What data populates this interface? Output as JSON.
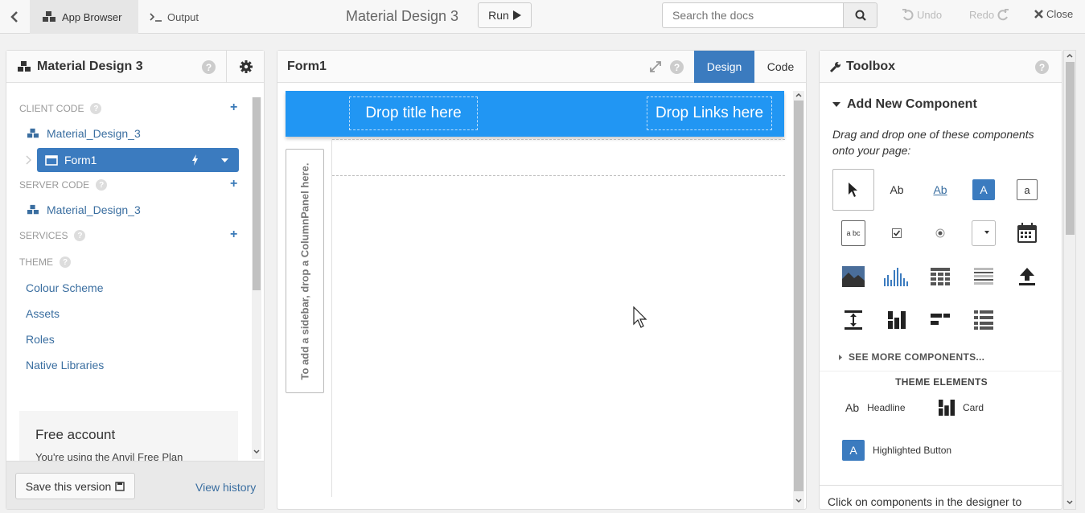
{
  "topbar": {
    "app_browser": "App Browser",
    "output": "Output",
    "app_title": "Material Design 3",
    "run": "Run",
    "search_placeholder": "Search the docs",
    "undo": "Undo",
    "redo": "Redo",
    "close": "Close"
  },
  "left": {
    "title": "Material Design 3",
    "client_code": "CLIENT CODE",
    "client_item": "Material_Design_3",
    "form_item": "Form1",
    "server_code": "SERVER CODE",
    "server_item": "Material_Design_3",
    "services": "SERVICES",
    "theme": "THEME",
    "theme_links": [
      "Colour Scheme",
      "Assets",
      "Roles",
      "Native Libraries"
    ],
    "free_title": "Free account",
    "free_text": "You're using the Anvil Free Plan",
    "save": "Save this version",
    "history": "View history"
  },
  "center": {
    "title": "Form1",
    "tab_design": "Design",
    "tab_code": "Code",
    "drop_title": "Drop title here",
    "drop_links": "Drop Links here",
    "sidebar_hint": "To add a sidebar, drop a ColumnPanel here."
  },
  "toolbox": {
    "title": "Toolbox",
    "heading": "Add New Component",
    "desc": "Drag and drop one of these components onto your page:",
    "label_sample": "Ab",
    "link_sample": "Ab",
    "button_sample": "A",
    "textbox_sample": "a",
    "textarea_sample": "a bc",
    "see_more": "SEE MORE COMPONENTS...",
    "theme_heading": "THEME ELEMENTS",
    "headline_sample": "Ab",
    "headline": "Headline",
    "card": "Card",
    "highlighted_sample": "A",
    "highlighted": "Highlighted Button",
    "footer": "Click on components in the designer to"
  },
  "colors": {
    "accent": "#3b7bbf",
    "appbar": "#2196f3"
  }
}
